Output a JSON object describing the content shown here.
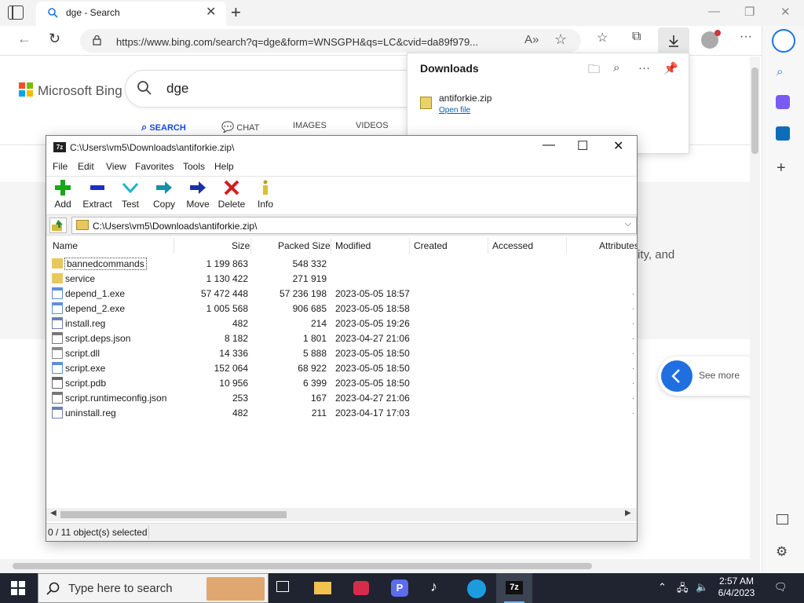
{
  "browser": {
    "tab_title": "dge - Search",
    "url": "https://www.bing.com/search?q=dge&form=WNSGPH&qs=LC&cvid=da89f979...",
    "colors": {
      "accent": "#1a73e8",
      "tabbar": "#f3f3f3"
    }
  },
  "bing": {
    "logo_text": "Microsoft Bing",
    "query": "dge",
    "tabs": [
      "SEARCH",
      "CHAT",
      "IMAGES",
      "VIDEOS"
    ],
    "snippet_text": "ity, and",
    "see_more": "See more"
  },
  "downloads": {
    "title": "Downloads",
    "items": [
      {
        "name": "antiforkie.zip",
        "action": "Open file"
      }
    ]
  },
  "zip": {
    "title": "C:\\Users\\vm5\\Downloads\\antiforkie.zip\\",
    "logo_text": "7z",
    "menu": [
      "File",
      "Edit",
      "View",
      "Favorites",
      "Tools",
      "Help"
    ],
    "toolbar": [
      "Add",
      "Extract",
      "Test",
      "Copy",
      "Move",
      "Delete",
      "Info"
    ],
    "path": "C:\\Users\\vm5\\Downloads\\antiforkie.zip\\",
    "columns": [
      "Name",
      "Size",
      "Packed Size",
      "Modified",
      "Created",
      "Accessed",
      "Attributes"
    ],
    "rows": [
      {
        "icon": "folder-icon",
        "name": "bannedcommands",
        "size": "1 199 863",
        "packed": "548 332",
        "modified": ""
      },
      {
        "icon": "folder-icon",
        "name": "service",
        "size": "1 130 422",
        "packed": "271 919",
        "modified": ""
      },
      {
        "icon": "exe-icon",
        "name": "depend_1.exe",
        "size": "57 472 448",
        "packed": "57 236 198",
        "modified": "2023-05-05 18:57"
      },
      {
        "icon": "exe-icon",
        "name": "depend_2.exe",
        "size": "1 005 568",
        "packed": "906 685",
        "modified": "2023-05-05 18:58"
      },
      {
        "icon": "reg-icon",
        "name": "install.reg",
        "size": "482",
        "packed": "214",
        "modified": "2023-05-05 19:26"
      },
      {
        "icon": "json-icon",
        "name": "script.deps.json",
        "size": "8 182",
        "packed": "1 801",
        "modified": "2023-04-27 21:06"
      },
      {
        "icon": "dll-icon",
        "name": "script.dll",
        "size": "14 336",
        "packed": "5 888",
        "modified": "2023-05-05 18:50"
      },
      {
        "icon": "exe-icon",
        "name": "script.exe",
        "size": "152 064",
        "packed": "68 922",
        "modified": "2023-05-05 18:50"
      },
      {
        "icon": "pdb-icon",
        "name": "script.pdb",
        "size": "10 956",
        "packed": "6 399",
        "modified": "2023-05-05 18:50"
      },
      {
        "icon": "json-icon",
        "name": "script.runtimeconfig.json",
        "size": "253",
        "packed": "167",
        "modified": "2023-04-27 21:06"
      },
      {
        "icon": "reg-icon",
        "name": "uninstall.reg",
        "size": "482",
        "packed": "211",
        "modified": "2023-04-17 17:03"
      }
    ],
    "status": "0 / 11 object(s) selected"
  },
  "taskbar": {
    "search_placeholder": "Type here to search",
    "time": "2:57 AM",
    "date": "6/4/2023"
  }
}
